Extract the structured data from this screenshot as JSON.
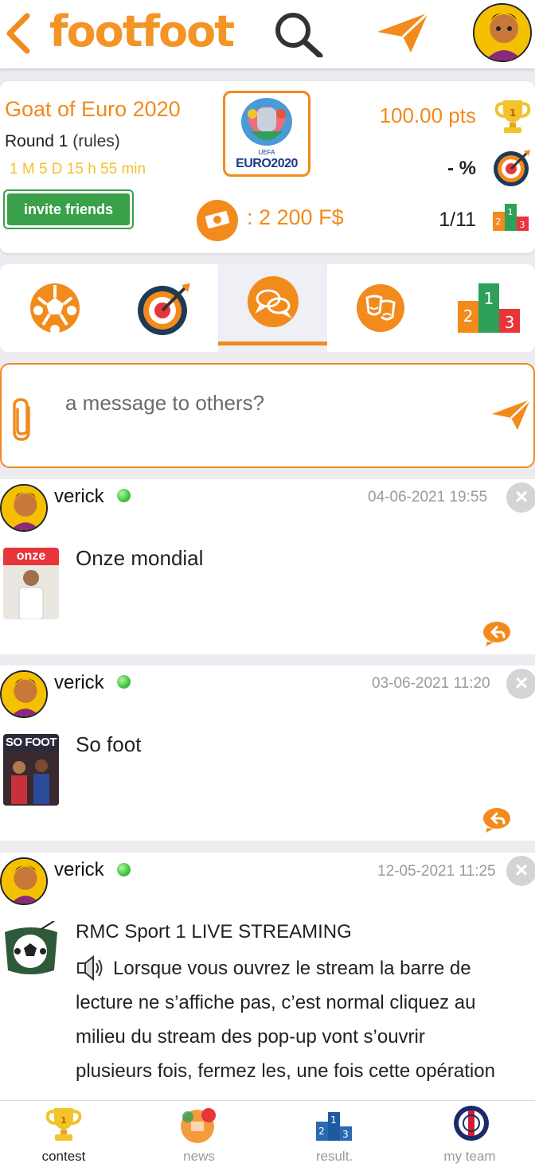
{
  "header": {
    "logo_text": "footfoot"
  },
  "contest": {
    "title": "Goat of Euro 2020",
    "round_label": "Round 1",
    "rules_label": "(rules)",
    "countdown": "1 M 5 D 15 h 55 min",
    "invite_label": "invite friends",
    "euro_logo_top": "UEFA",
    "euro_logo_text": "EURO2020",
    "points": "100.00 pts",
    "accuracy": "- %",
    "prize": ": 2 200 F$",
    "rank": "1/11"
  },
  "tabs": [
    {
      "name": "football"
    },
    {
      "name": "target"
    },
    {
      "name": "chat",
      "active": true
    },
    {
      "name": "theater"
    },
    {
      "name": "podium"
    }
  ],
  "composer": {
    "placeholder": "a message to others?"
  },
  "posts": [
    {
      "user": "verick",
      "date": "04-06-2021 19:55",
      "text": "Onze mondial",
      "thumb_label": "onze"
    },
    {
      "user": "verick",
      "date": "03-06-2021 11:20",
      "text": "So foot",
      "thumb_label": "SO FOOT"
    },
    {
      "user": "verick",
      "date": "12-05-2021 11:25",
      "title": "RMC Sport 1 LIVE STREAMING",
      "lines": [
        "Lorsque vous ouvrez le stream la barre de",
        "lecture ne s’affiche pas, c’est normal cliquez au",
        "milieu du stream des pop-up vont s’ouvrir",
        "plusieurs fois, fermez les, une fois cette opération"
      ]
    }
  ],
  "bottom_nav": [
    {
      "label": "contest",
      "active": true
    },
    {
      "label": "news"
    },
    {
      "label": "result."
    },
    {
      "label": "my team"
    }
  ],
  "colors": {
    "accent": "#f28a1c",
    "green": "#3aa04a",
    "gold": "#f2c32a"
  }
}
